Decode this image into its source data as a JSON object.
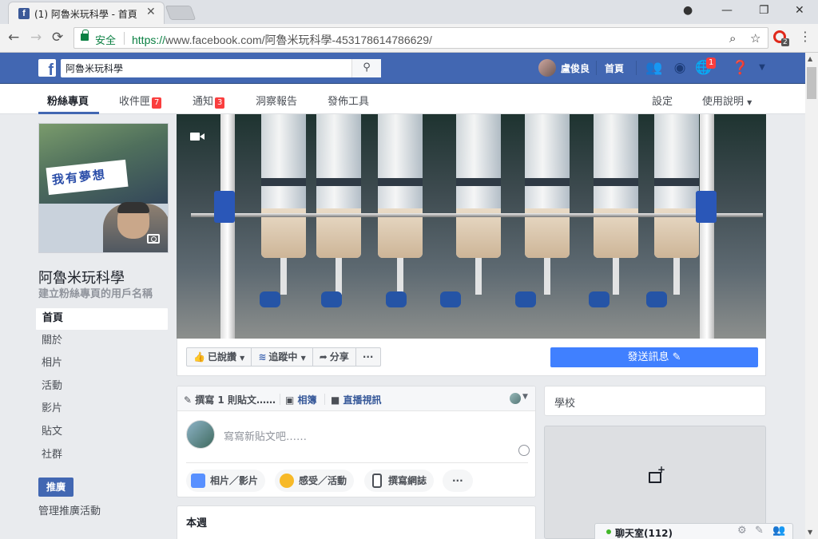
{
  "browser": {
    "tab_title": "(1) 阿魯米玩科學 - 首頁",
    "tab_close": "✕",
    "secure_label": "安全",
    "url_scheme": "https://",
    "url_rest": "www.facebook.com/阿魯米玩科學-453178614786629/",
    "extension_badge": "2",
    "window_controls": [
      "—",
      "❐",
      "✕"
    ]
  },
  "fb_header": {
    "logo": "f",
    "search_value": "阿魯米玩科學",
    "user_name": "盧俊良",
    "home_label": "首頁",
    "notifications_badge": "1"
  },
  "page_nav": {
    "tabs": [
      {
        "label": "粉絲專頁",
        "badge": ""
      },
      {
        "label": "收件匣",
        "badge": "7"
      },
      {
        "label": "通知",
        "badge": "3"
      },
      {
        "label": "洞察報告",
        "badge": ""
      },
      {
        "label": "發佈工具",
        "badge": ""
      }
    ],
    "settings_label": "設定",
    "help_label": "使用說明"
  },
  "profile": {
    "sign_text": "我有夢想",
    "page_name": "阿魯米玩科學",
    "username_prompt": "建立粉絲專頁的用戶名稱"
  },
  "left_nav": {
    "items": [
      "首頁",
      "關於",
      "相片",
      "活動",
      "影片",
      "貼文",
      "社群"
    ],
    "promote_label": "推廣",
    "manage_promotions_label": "管理推廣活動"
  },
  "action_bar": {
    "liked_label": "已說讚",
    "following_label": "追蹤中",
    "share_label": "分享",
    "more_label": "···",
    "send_message_label": "發送訊息"
  },
  "composer": {
    "tab_write": "撰寫 1 則貼文……",
    "tab_photo": "相簿",
    "tab_live": "直播視訊",
    "placeholder": "寫寫新貼文吧……",
    "pill_photo": "相片／影片",
    "pill_feeling": "感受／活動",
    "pill_note": "撰寫網誌",
    "pill_more": "···"
  },
  "this_week": {
    "title": "本週"
  },
  "right_column": {
    "school_label": "學校"
  },
  "chat": {
    "label": "聊天室(112)"
  },
  "colors": {
    "facebook_blue": "#4267b2",
    "message_button": "#4080ff",
    "badge_red": "#fa3e3e",
    "secure_green": "#0b8043"
  }
}
